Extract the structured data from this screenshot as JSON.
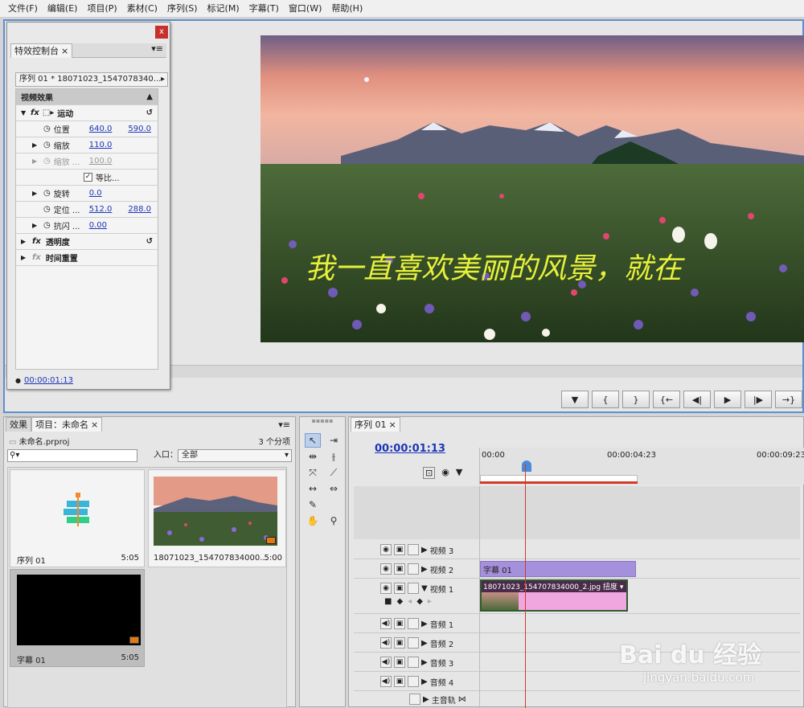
{
  "menu": [
    "文件(F)",
    "编辑(E)",
    "项目(P)",
    "素材(C)",
    "序列(S)",
    "标记(M)",
    "字幕(T)",
    "窗口(W)",
    "帮助(H)"
  ],
  "effect_controls": {
    "close_label": "x",
    "tab_label": "特效控制台",
    "sequence_label": "序列 01 * 18071023_1547078340...",
    "section_video": "视频效果",
    "motion": "运动",
    "position_label": "位置",
    "position_x": "640.0",
    "position_y": "590.0",
    "scale_label": "缩放",
    "scale_value": "110.0",
    "scale_width_label": "缩放 ...",
    "scale_width_value": "100.0",
    "uniform_scale": "等比...",
    "rotation_label": "旋转",
    "rotation_value": "0.0",
    "anchor_label": "定位 ...",
    "anchor_x": "512.0",
    "anchor_y": "288.0",
    "antiflicker_label": "抗闪 ...",
    "antiflicker_value": "0.00",
    "opacity": "透明度",
    "time_remap": "时间重置",
    "timecode": "00:00:01:13"
  },
  "monitor": {
    "overlay_text": "我一直喜欢美丽的风景，就在",
    "left_marker": "0"
  },
  "transport": [
    "▼",
    "{",
    "}",
    "{←",
    "◀|",
    "▶",
    "|▶",
    "→}"
  ],
  "project": {
    "tab_effects": "效果",
    "tab_project": "项目：未命名",
    "project_file": "未命名.prproj",
    "item_count": "3 个分项",
    "search_placeholder": "",
    "entry_label": "入口：",
    "entry_value": "全部",
    "items": [
      {
        "name": "序列 01",
        "duration": "5:05"
      },
      {
        "name": "18071023_154707834000...",
        "duration": "5:00"
      },
      {
        "name": "字幕 01",
        "duration": "5:05"
      }
    ]
  },
  "timeline": {
    "tab_label": "序列 01",
    "timecode": "00:00:01:13",
    "ruler": [
      "00:00",
      "00:00:04:23",
      "00:00:09:23"
    ],
    "tracks": [
      "视频 3",
      "视频 2",
      "视频 1",
      "音频 1",
      "音频 2",
      "音频 3",
      "音频 4",
      "主音轨"
    ],
    "clip_title": "字幕 01",
    "clip_image": "18071023_154707834000_2.jpg",
    "clip_image_suffix": "扭度"
  },
  "watermark": {
    "brand": "Bai du 经验",
    "url": "jingyan.baidu.com"
  },
  "colors": {
    "accent_blue": "#5b8fd0",
    "clip_purple": "#a590dc",
    "clip_pink": "#f0a7e0",
    "playhead_red": "#d23a2a"
  }
}
